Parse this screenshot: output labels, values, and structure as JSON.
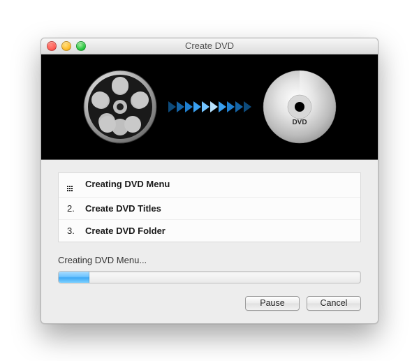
{
  "window": {
    "title": "Create DVD"
  },
  "hero": {
    "dvd_label": "DVD"
  },
  "steps": [
    {
      "num": "",
      "label": "Creating DVD Menu",
      "active": true
    },
    {
      "num": "2.",
      "label": "Create DVD Titles",
      "active": false
    },
    {
      "num": "3.",
      "label": "Create DVD Folder",
      "active": false
    }
  ],
  "status": {
    "text": "Creating DVD Menu...",
    "progress_percent": 10
  },
  "buttons": {
    "pause": "Pause",
    "cancel": "Cancel"
  }
}
